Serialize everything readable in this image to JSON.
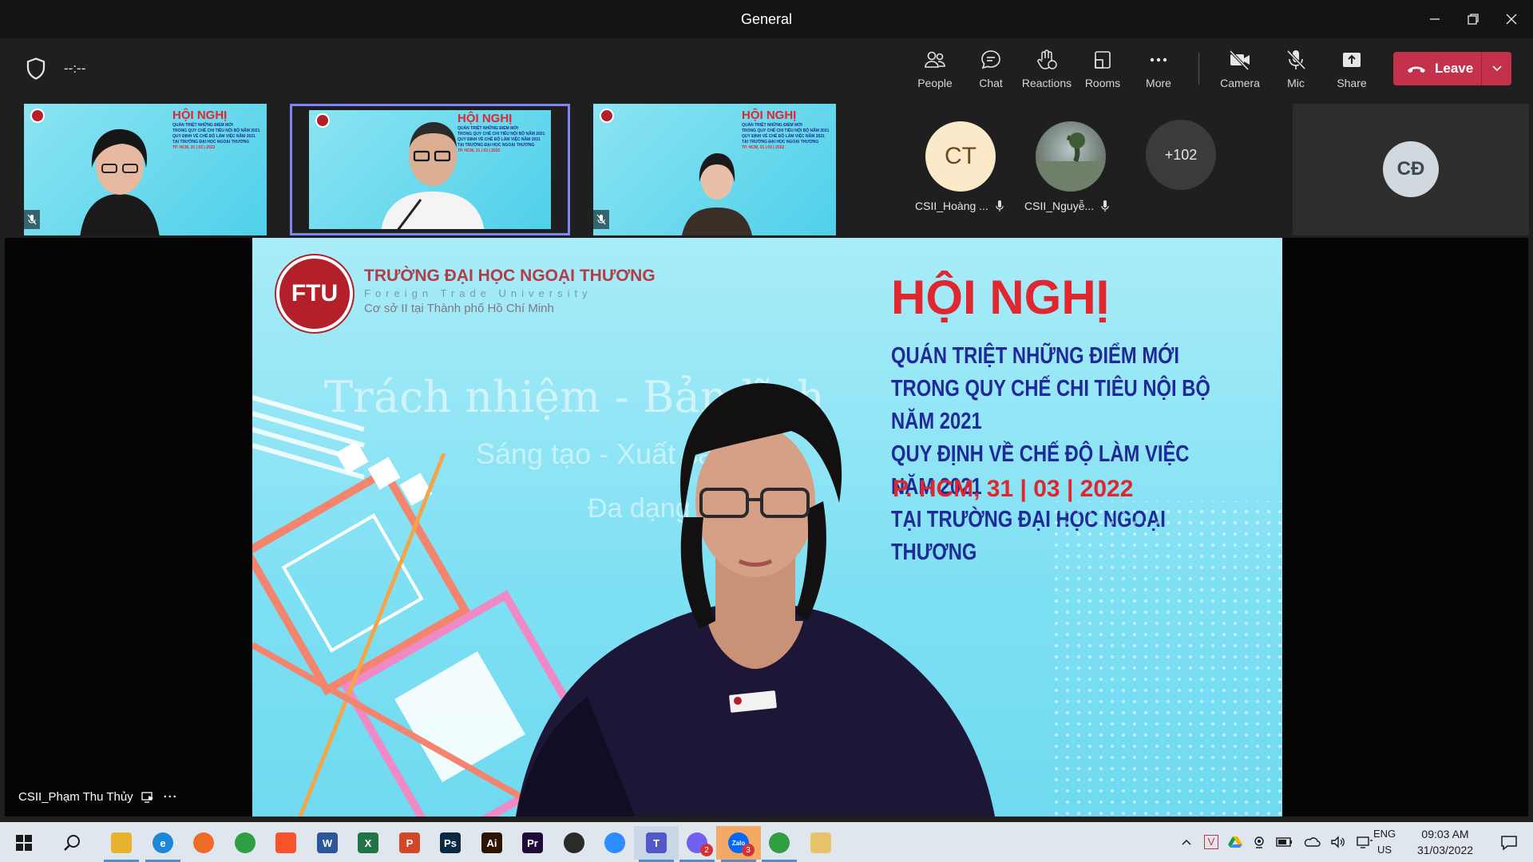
{
  "window": {
    "title": "General"
  },
  "toolbar": {
    "timer": "--:--",
    "buttons": {
      "people": "People",
      "chat": "Chat",
      "reactions": "Reactions",
      "rooms": "Rooms",
      "more": "More",
      "camera": "Camera",
      "mic": "Mic",
      "share": "Share"
    },
    "leave_label": "Leave",
    "leave_color": "#c4314b"
  },
  "participants": {
    "thumb_slide_title": "HỘI NGHỊ",
    "thumb_slide_lines": [
      "QUÁN TRIỆT NHỮNG ĐIỂM MỚI",
      "TRONG QUY CHẾ CHI TIÊU NỘI BỘ NĂM 2021",
      "QUY ĐỊNH VỀ CHẾ ĐỘ LÀM VIỆC NĂM 2021",
      "TẠI TRƯỜNG ĐẠI HỌC NGOẠI THƯƠNG",
      "TP. HCM, 31 | 03 | 2022"
    ],
    "avatars": [
      {
        "initials": "CT",
        "name": "CSII_Hoàng ..."
      },
      {
        "initials": "",
        "name": "CSII_Nguyễ..."
      }
    ],
    "overflow_count": "+102",
    "cd_initials": "CĐ"
  },
  "stage": {
    "uni_name": "TRƯỜNG ĐẠI HỌC NGOẠI THƯƠNG",
    "uni_english": "Foreign Trade University",
    "uni_sub": "Cơ sở II tại Thành phố Hồ Chí Minh",
    "motto_1": "Trách nhiệm - Bản lĩnh",
    "motto_2": "Sáng tạo - Xuất sắc",
    "motto_3": "Đa dạng",
    "title": "HỘI NGHỊ",
    "lines": [
      "QUÁN TRIỆT NHỮNG ĐIỂM MỚI",
      "TRONG QUY CHẾ CHI TIÊU NỘI BỘ NĂM 2021",
      "QUY ĐỊNH VỀ CHẾ ĐỘ LÀM VIỆC NĂM 2021",
      "TẠI TRƯỜNG ĐẠI HỌC NGOẠI THƯƠNG"
    ],
    "date": "P. HCM, 31 | 03 | 2022",
    "speaker_name": "CSII_Phạm Thu Thủy",
    "speaker_more": "···"
  },
  "taskbar": {
    "apps": [
      {
        "name": "file-explorer",
        "color": "#e8b22c",
        "glyph": ""
      },
      {
        "name": "edge",
        "color": "#1b87d6",
        "glyph": "e"
      },
      {
        "name": "firefox",
        "color": "#f06a27",
        "glyph": ""
      },
      {
        "name": "chrome",
        "color": "#2f9e44",
        "glyph": ""
      },
      {
        "name": "brave",
        "color": "#fb542b",
        "glyph": ""
      },
      {
        "name": "word",
        "color": "#2b579a",
        "glyph": "W"
      },
      {
        "name": "excel",
        "color": "#217346",
        "glyph": "X"
      },
      {
        "name": "powerpoint",
        "color": "#d24726",
        "glyph": "P"
      },
      {
        "name": "photoshop",
        "color": "#0a2a44",
        "glyph": "Ps"
      },
      {
        "name": "illustrator",
        "color": "#2e1400",
        "glyph": "Ai"
      },
      {
        "name": "premiere",
        "color": "#1f0a3a",
        "glyph": "Pr"
      },
      {
        "name": "obs",
        "color": "#2a2a2a",
        "glyph": ""
      },
      {
        "name": "zoom",
        "color": "#2d8cff",
        "glyph": ""
      },
      {
        "name": "teams",
        "color": "#5059c9",
        "glyph": "T"
      },
      {
        "name": "viber",
        "color": "#7360f2",
        "glyph": ""
      },
      {
        "name": "zalo",
        "color": "#0068ff",
        "glyph": "Zalo"
      },
      {
        "name": "chrome-2",
        "color": "#2f9e44",
        "glyph": ""
      },
      {
        "name": "paint",
        "color": "#e7c36a",
        "glyph": ""
      }
    ],
    "badges": {
      "viber": "2",
      "zalo": "3"
    },
    "lang_1": "ENG",
    "lang_2": "US",
    "time": "09:03 AM",
    "date": "31/03/2022"
  }
}
